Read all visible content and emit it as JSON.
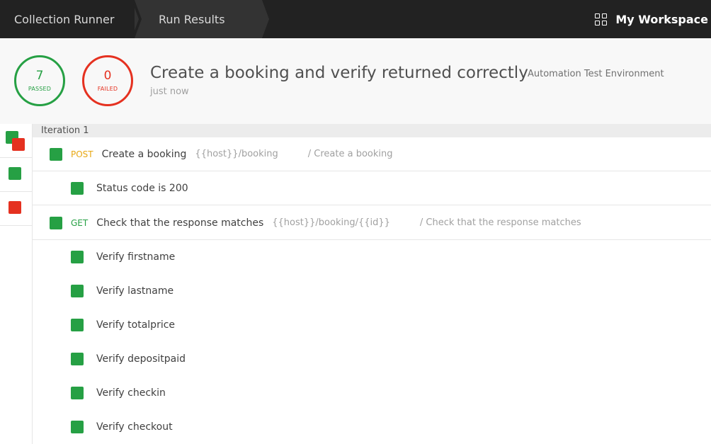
{
  "topbar": {
    "breadcrumb": [
      "Collection Runner",
      "Run Results"
    ],
    "workspace_label": "My Workspace",
    "workspace_icon": "grid-icon"
  },
  "summary": {
    "passed_count": "7",
    "passed_label": "PASSED",
    "failed_count": "0",
    "failed_label": "FAILED",
    "title": "Create a booking and verify returned correctly",
    "environment": "Automation Test Environment",
    "timestamp": "just now"
  },
  "colors": {
    "passed": "#26a044",
    "failed": "#e53120",
    "post": "#e8a812",
    "get": "#26a044",
    "topbar_bg": "#222222"
  },
  "sidebar": {
    "items": [
      {
        "status": "mixed"
      },
      {
        "status": "passed"
      },
      {
        "status": "failed"
      }
    ]
  },
  "iteration": {
    "label": "Iteration 1",
    "requests": [
      {
        "method": "POST",
        "name": "Create a booking",
        "url": "{{host}}/booking",
        "path": "/ Create a booking",
        "tests": [
          {
            "name": "Status code is 200",
            "status": "passed"
          }
        ]
      },
      {
        "method": "GET",
        "name": "Check that the response matches",
        "url": "{{host}}/booking/{{id}}",
        "path": "/ Check that the response matches",
        "tests": [
          {
            "name": "Verify firstname",
            "status": "passed"
          },
          {
            "name": "Verify lastname",
            "status": "passed"
          },
          {
            "name": "Verify totalprice",
            "status": "passed"
          },
          {
            "name": "Verify depositpaid",
            "status": "passed"
          },
          {
            "name": "Verify checkin",
            "status": "passed"
          },
          {
            "name": "Verify checkout",
            "status": "passed"
          }
        ]
      }
    ]
  }
}
